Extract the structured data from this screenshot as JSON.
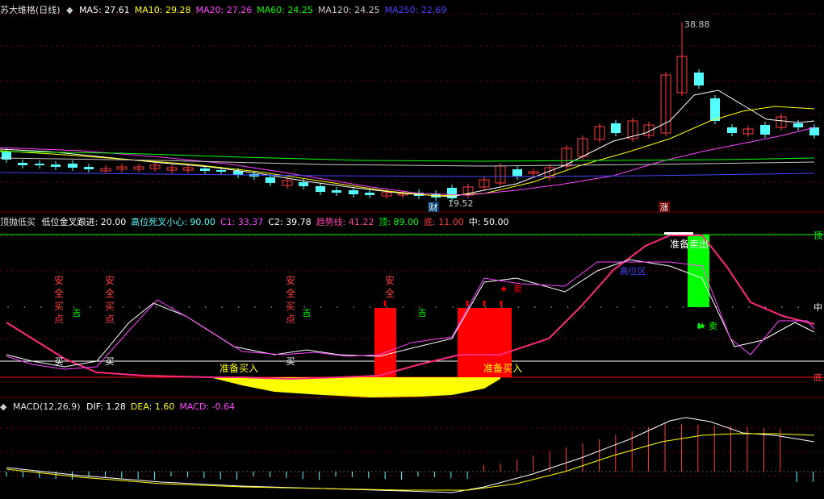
{
  "colors": {
    "up": "#ff3c3c",
    "down": "#54ffff",
    "ma5": "#ffffff",
    "ma10": "#ffff00",
    "ma20": "#ff44ff",
    "ma60": "#00ff00",
    "ma120": "#c8c8c8",
    "ma250": "#4444ff",
    "grid": "#7a0000",
    "buy": "#ff0000",
    "sell": "#00ff00",
    "yellow": "#ffff00"
  },
  "main": {
    "title": "苏大维格(日线)",
    "indicators": [
      {
        "label": "MA5: 27.61",
        "color": "#ffffff"
      },
      {
        "label": "MA10: 29.28",
        "color": "#ffff00"
      },
      {
        "label": "MA20: 27.26",
        "color": "#ff44ff"
      },
      {
        "label": "MA60: 24.25",
        "color": "#00ff00"
      },
      {
        "label": "MA120: 24.25",
        "color": "#c8c8c8"
      },
      {
        "label": "MA250: 22.69",
        "color": "#4444ff"
      }
    ],
    "high_label": "38.88",
    "low_label": "19.52",
    "cai_badge": "财",
    "zhang_badge": "涨"
  },
  "sub1": {
    "title": "顶抛低买",
    "indicators": [
      {
        "label": "低位金叉跟进: 20.00",
        "color": "#ffffff"
      },
      {
        "label": "高位死叉小心: 90.00",
        "color": "#54ffff"
      },
      {
        "label": "C1: 33.37",
        "color": "#ff44ff"
      },
      {
        "label": "C2: 39.78",
        "color": "#ffffff"
      },
      {
        "label": "趋势线: 41.22",
        "color": "#ff44aa"
      },
      {
        "label": "顶: 89.00",
        "color": "#00ff00"
      },
      {
        "label": "底: 11.00",
        "color": "#ff3c3c"
      },
      {
        "label": "中: 50.00",
        "color": "#ffffff"
      }
    ],
    "right_ding": "顶",
    "right_zhong": "中",
    "right_di": "底",
    "safe_buy": [
      "安",
      "全",
      "买",
      "点"
    ],
    "safe_short": [
      "安",
      "全"
    ],
    "buy_label": "买",
    "prepare_buy": "准备买入",
    "prepare_sell": "准备卖出",
    "sell_label": "卖",
    "high_zone": "高位区",
    "ji": "吉"
  },
  "macd": {
    "title": "MACD(12,26,9)",
    "indicators": [
      {
        "label": "DIF: 1.28",
        "color": "#ffffff"
      },
      {
        "label": "DEA: 1.60",
        "color": "#ffff00"
      },
      {
        "label": "MACD: -0.64",
        "color": "#ff44ff"
      }
    ]
  }
}
